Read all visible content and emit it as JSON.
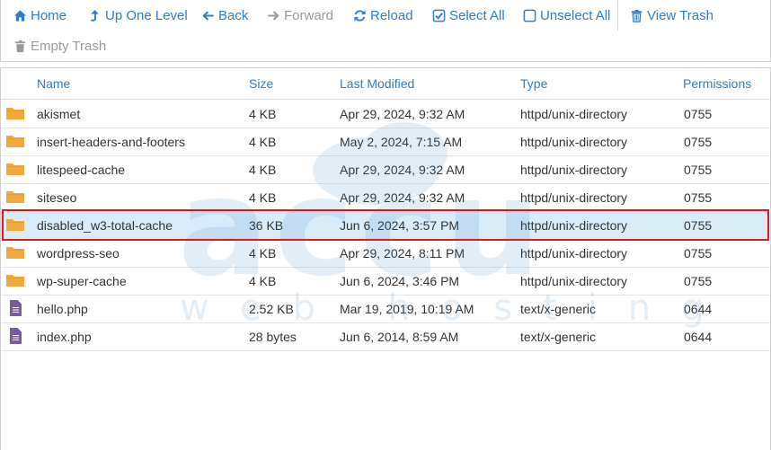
{
  "toolbar": {
    "home": "Home",
    "up": "Up One Level",
    "back": "Back",
    "forward": "Forward",
    "reload": "Reload",
    "select_all": "Select All",
    "unselect_all": "Unselect All",
    "view_trash": "View Trash",
    "empty_trash": "Empty Trash"
  },
  "columns": {
    "name": "Name",
    "size": "Size",
    "modified": "Last Modified",
    "type": "Type",
    "permissions": "Permissions"
  },
  "rows": [
    {
      "icon": "folder-icon",
      "name": "akismet",
      "size": "4 KB",
      "modified": "Apr 29, 2024, 9:32 AM",
      "type": "httpd/unix-directory",
      "perm": "0755"
    },
    {
      "icon": "folder-icon",
      "name": "insert-headers-and-footers",
      "size": "4 KB",
      "modified": "May 2, 2024, 7:15 AM",
      "type": "httpd/unix-directory",
      "perm": "0755"
    },
    {
      "icon": "folder-icon",
      "name": "litespeed-cache",
      "size": "4 KB",
      "modified": "Apr 29, 2024, 9:32 AM",
      "type": "httpd/unix-directory",
      "perm": "0755"
    },
    {
      "icon": "folder-icon",
      "name": "siteseo",
      "size": "4 KB",
      "modified": "Apr 29, 2024, 9:32 AM",
      "type": "httpd/unix-directory",
      "perm": "0755"
    },
    {
      "icon": "folder-icon",
      "name": "disabled_w3-total-cache",
      "size": "36 KB",
      "modified": "Jun 6, 2024, 3:57 PM",
      "type": "httpd/unix-directory",
      "perm": "0755"
    },
    {
      "icon": "folder-icon",
      "name": "wordpress-seo",
      "size": "4 KB",
      "modified": "Apr 29, 2024, 8:11 PM",
      "type": "httpd/unix-directory",
      "perm": "0755"
    },
    {
      "icon": "folder-icon",
      "name": "wp-super-cache",
      "size": "4 KB",
      "modified": "Jun 6, 2024, 3:46 PM",
      "type": "httpd/unix-directory",
      "perm": "0755"
    },
    {
      "icon": "file-icon",
      "name": "hello.php",
      "size": "2.52 KB",
      "modified": "Mar 19, 2019, 10:19 AM",
      "type": "text/x-generic",
      "perm": "0644"
    },
    {
      "icon": "file-icon",
      "name": "index.php",
      "size": "28 bytes",
      "modified": "Jun 6, 2014, 8:59 AM",
      "type": "text/x-generic",
      "perm": "0644"
    }
  ],
  "selected_row": "disabled_w3-total-cache",
  "watermark": {
    "brand": "accu",
    "tagline": "web hosting"
  },
  "colors": {
    "link": "#2f7dc2",
    "folder": "#f0a93a",
    "file": "#7a5aa0",
    "selected_bg": "#d9ecf9",
    "highlight": "#e01919"
  }
}
